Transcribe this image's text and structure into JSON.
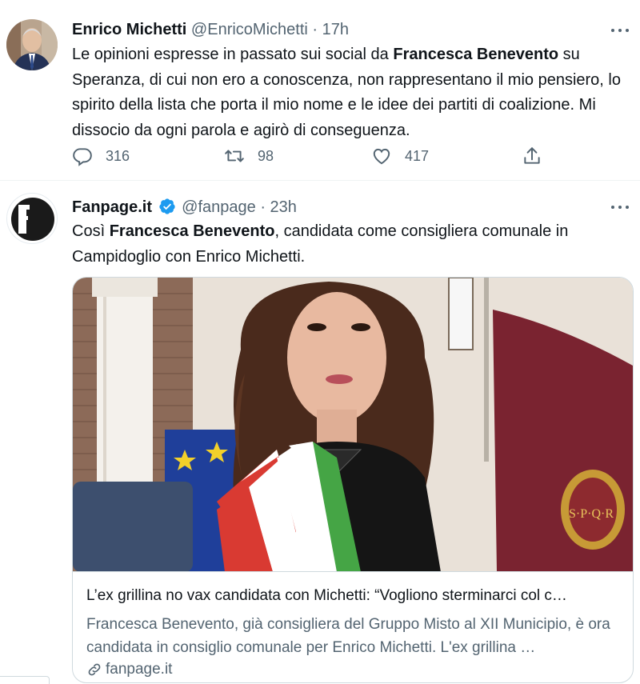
{
  "tweet1": {
    "name": "Enrico Michetti",
    "handle": "@EnricoMichetti",
    "separator": "·",
    "time": "17h",
    "text_parts": [
      "Le opinioni espresse in passato sui social da ",
      "Francesca Benevento",
      " su Speranza, di cui non ero a conoscenza, non rappresentano il mio pensiero, lo spirito della lista che porta il mio nome e le idee dei partiti di coalizione. Mi dissocio da ogni parola e agirò di conseguenza."
    ],
    "replies": "316",
    "retweets": "98",
    "likes": "417"
  },
  "tweet2": {
    "name": "Fanpage.it",
    "handle": "@fanpage",
    "separator": "·",
    "time": "23h",
    "text_parts": [
      "Così ",
      "Francesca Benevento",
      ", candidata come consigliera comunale in Campidoglio con Enrico Michetti."
    ],
    "card": {
      "title": "L’ex grillina no vax candidata con Michetti: “Vogliono sterminarci col c…",
      "description": "Francesca Benevento, già consigliera del Gruppo Misto al XII Municipio, è ora candidata in consiglio comunale per Enrico Michetti. L'ex grillina …",
      "domain": "fanpage.it",
      "flag_text": "S·P·Q·R"
    }
  },
  "icons": {
    "reply": "reply-icon",
    "retweet": "retweet-icon",
    "like": "like-icon",
    "share": "share-icon",
    "more": "more-icon",
    "verified": "verified-badge-icon",
    "link": "link-icon"
  },
  "colors": {
    "text": "#0f1419",
    "secondary": "#536471",
    "verified": "#1d9bf0",
    "border": "#cfd9de"
  }
}
